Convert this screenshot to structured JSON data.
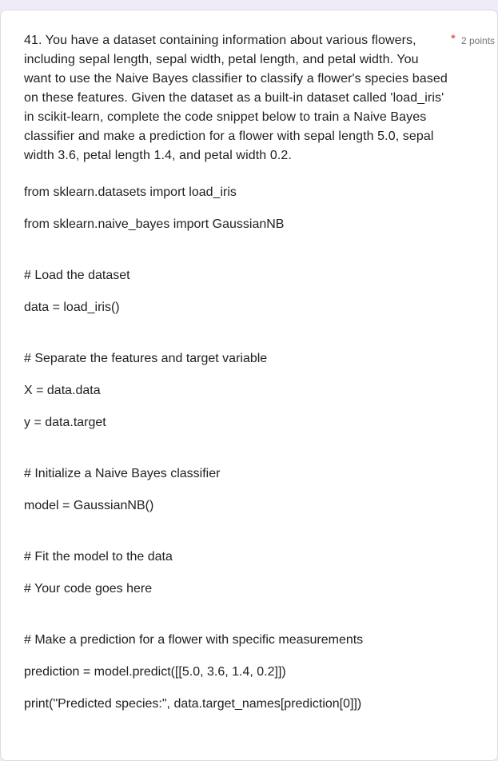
{
  "question": {
    "text": "41. You have a dataset containing information about various flowers, including sepal length, sepal width, petal length, and petal width. You want to use the Naive Bayes classifier to classify a flower's species based on these features. Given the dataset as a built-in dataset called 'load_iris' in scikit-learn, complete the code snippet below to train a Naive Bayes classifier and make a prediction for a flower with sepal length 5.0, sepal width 3.6, petal length 1.4, and petal width 0.2.",
    "required_marker": "*",
    "points": "2 points"
  },
  "code_lines": [
    "from sklearn.datasets import load_iris",
    "from sklearn.naive_bayes import GaussianNB",
    "# Load the dataset",
    "data = load_iris()",
    "# Separate the features and target variable",
    "X = data.data",
    "y = data.target",
    "# Initialize a Naive Bayes classifier",
    "model = GaussianNB()",
    "# Fit the model to the data",
    "# Your code goes here",
    "# Make a prediction for a flower with specific measurements",
    "prediction = model.predict([[5.0, 3.6, 1.4, 0.2]])",
    "print(\"Predicted species:\", data.target_names[prediction[0]])"
  ]
}
